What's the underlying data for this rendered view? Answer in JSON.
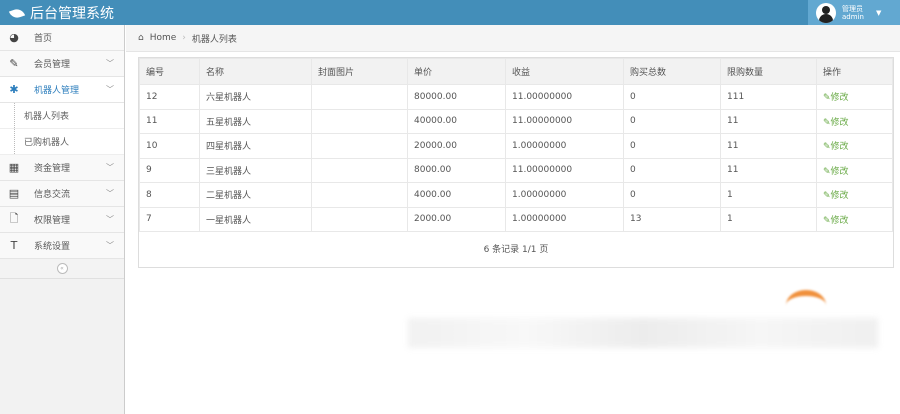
{
  "app": {
    "title": "后台管理系统",
    "user_role": "管理员",
    "user_name": "admin"
  },
  "sidebar": {
    "items": [
      {
        "label": "首页",
        "icon": "dashboard-icon"
      },
      {
        "label": "会员管理",
        "icon": "edit-icon"
      },
      {
        "label": "机器人管理",
        "icon": "asterisk-icon"
      },
      {
        "label": "资金管理",
        "icon": "calendar-icon"
      },
      {
        "label": "信息交流",
        "icon": "list-icon"
      },
      {
        "label": "权限管理",
        "icon": "file-icon"
      },
      {
        "label": "系统设置",
        "icon": "text-icon"
      }
    ],
    "sub_items": [
      "机器人列表",
      "已购机器人"
    ]
  },
  "breadcrumb": {
    "home": "Home",
    "current": "机器人列表"
  },
  "table": {
    "headers": [
      "编号",
      "名称",
      "封面图片",
      "单价",
      "收益",
      "购买总数",
      "限购数量",
      "操作"
    ],
    "rows": [
      [
        "12",
        "六星机器人",
        "",
        "80000.00",
        "11.00000000",
        "0",
        "111",
        "修改"
      ],
      [
        "11",
        "五星机器人",
        "",
        "40000.00",
        "11.00000000",
        "0",
        "11",
        "修改"
      ],
      [
        "10",
        "四星机器人",
        "",
        "20000.00",
        "1.00000000",
        "0",
        "11",
        "修改"
      ],
      [
        "9",
        "三星机器人",
        "",
        "8000.00",
        "11.00000000",
        "0",
        "11",
        "修改"
      ],
      [
        "8",
        "二星机器人",
        "",
        "4000.00",
        "1.00000000",
        "0",
        "1",
        "修改"
      ],
      [
        "7",
        "一星机器人",
        "",
        "2000.00",
        "1.00000000",
        "13",
        "1",
        "修改"
      ]
    ],
    "footer": "6 条记录 1/1 页"
  },
  "colors": {
    "header": "#438eb9",
    "active": "#2b7dbc",
    "edit": "#69aa46"
  }
}
